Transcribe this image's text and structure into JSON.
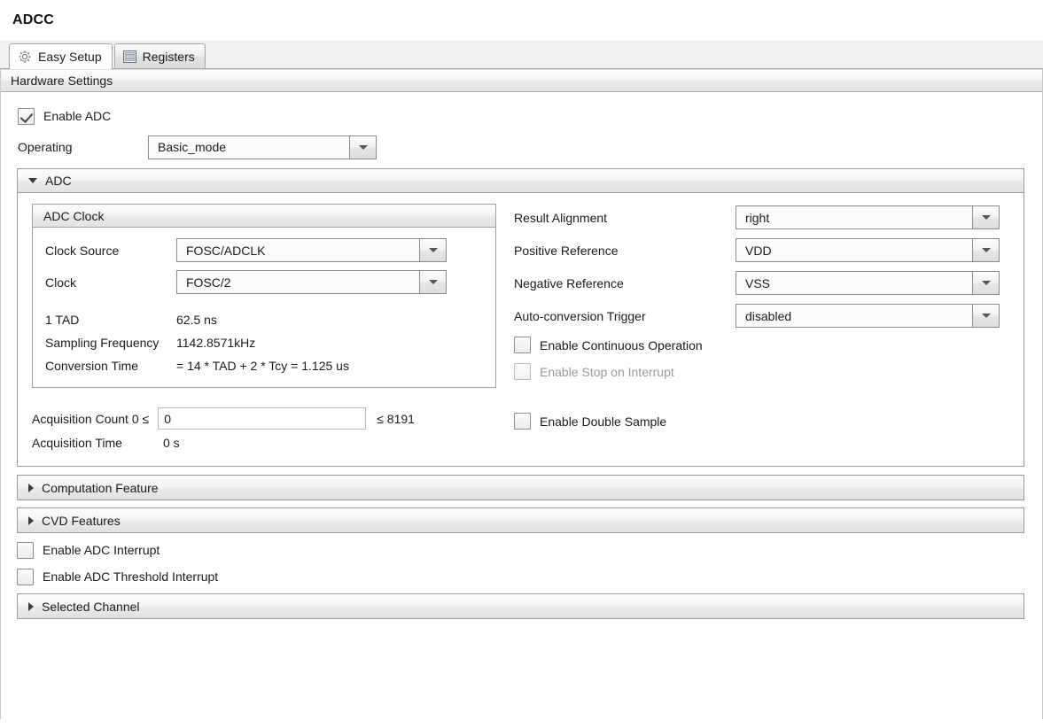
{
  "window": {
    "title": "ADCC"
  },
  "tabs": [
    {
      "label": "Easy Setup",
      "icon": "gear-icon",
      "active": true
    },
    {
      "label": "Registers",
      "icon": "registers-icon",
      "active": false
    }
  ],
  "hardware_settings": {
    "label": "Hardware Settings"
  },
  "enable_adc": {
    "label": "Enable ADC",
    "checked": true
  },
  "operating": {
    "label": "Operating",
    "value": "Basic_mode"
  },
  "adc_section": {
    "label": "ADC",
    "expanded": true,
    "adc_clock_group": {
      "label": "ADC Clock",
      "clock_source": {
        "label": "Clock Source",
        "value": "FOSC/ADCLK"
      },
      "clock": {
        "label": "Clock",
        "value": "FOSC/2"
      },
      "info": [
        {
          "label": "1 TAD",
          "value": "62.5 ns"
        },
        {
          "label": "Sampling Frequency",
          "value": "1142.8571kHz"
        },
        {
          "label": "Conversion Time",
          "value": "= 14 * TAD + 2 * Tcy = 1.125 us"
        }
      ]
    },
    "acquisition": {
      "count_label": "Acquisition Count 0 ≤",
      "count_value": "0",
      "count_max": "≤ 8191",
      "time_label": "Acquisition Time",
      "time_value": "0 s"
    },
    "result_alignment": {
      "label": "Result Alignment",
      "value": "right"
    },
    "positive_reference": {
      "label": "Positive Reference",
      "value": "VDD"
    },
    "negative_reference": {
      "label": "Negative Reference",
      "value": "VSS"
    },
    "auto_conversion_trigger": {
      "label": "Auto-conversion Trigger",
      "value": "disabled"
    },
    "enable_continuous_operation": {
      "label": "Enable Continuous Operation",
      "checked": false,
      "disabled": false
    },
    "enable_stop_on_interrupt": {
      "label": "Enable Stop on Interrupt",
      "checked": false,
      "disabled": true
    },
    "enable_double_sample": {
      "label": "Enable Double Sample",
      "checked": false,
      "disabled": false
    }
  },
  "computation_feature": {
    "label": "Computation Feature",
    "expanded": false
  },
  "cvd_features": {
    "label": "CVD Features",
    "expanded": false
  },
  "enable_adc_interrupt": {
    "label": "Enable ADC Interrupt",
    "checked": false
  },
  "enable_adc_threshold_interrupt": {
    "label": "Enable ADC Threshold Interrupt",
    "checked": false
  },
  "selected_channel": {
    "label": "Selected Channel",
    "expanded": false
  },
  "colors": {
    "accent": "#2a64a8",
    "border": "#9b9b9b",
    "panel_bg": "#ffffff",
    "header_gradient_top": "#fdfdfd",
    "header_gradient_bottom": "#e1e1e1",
    "disabled_text": "#9a9a9a"
  }
}
